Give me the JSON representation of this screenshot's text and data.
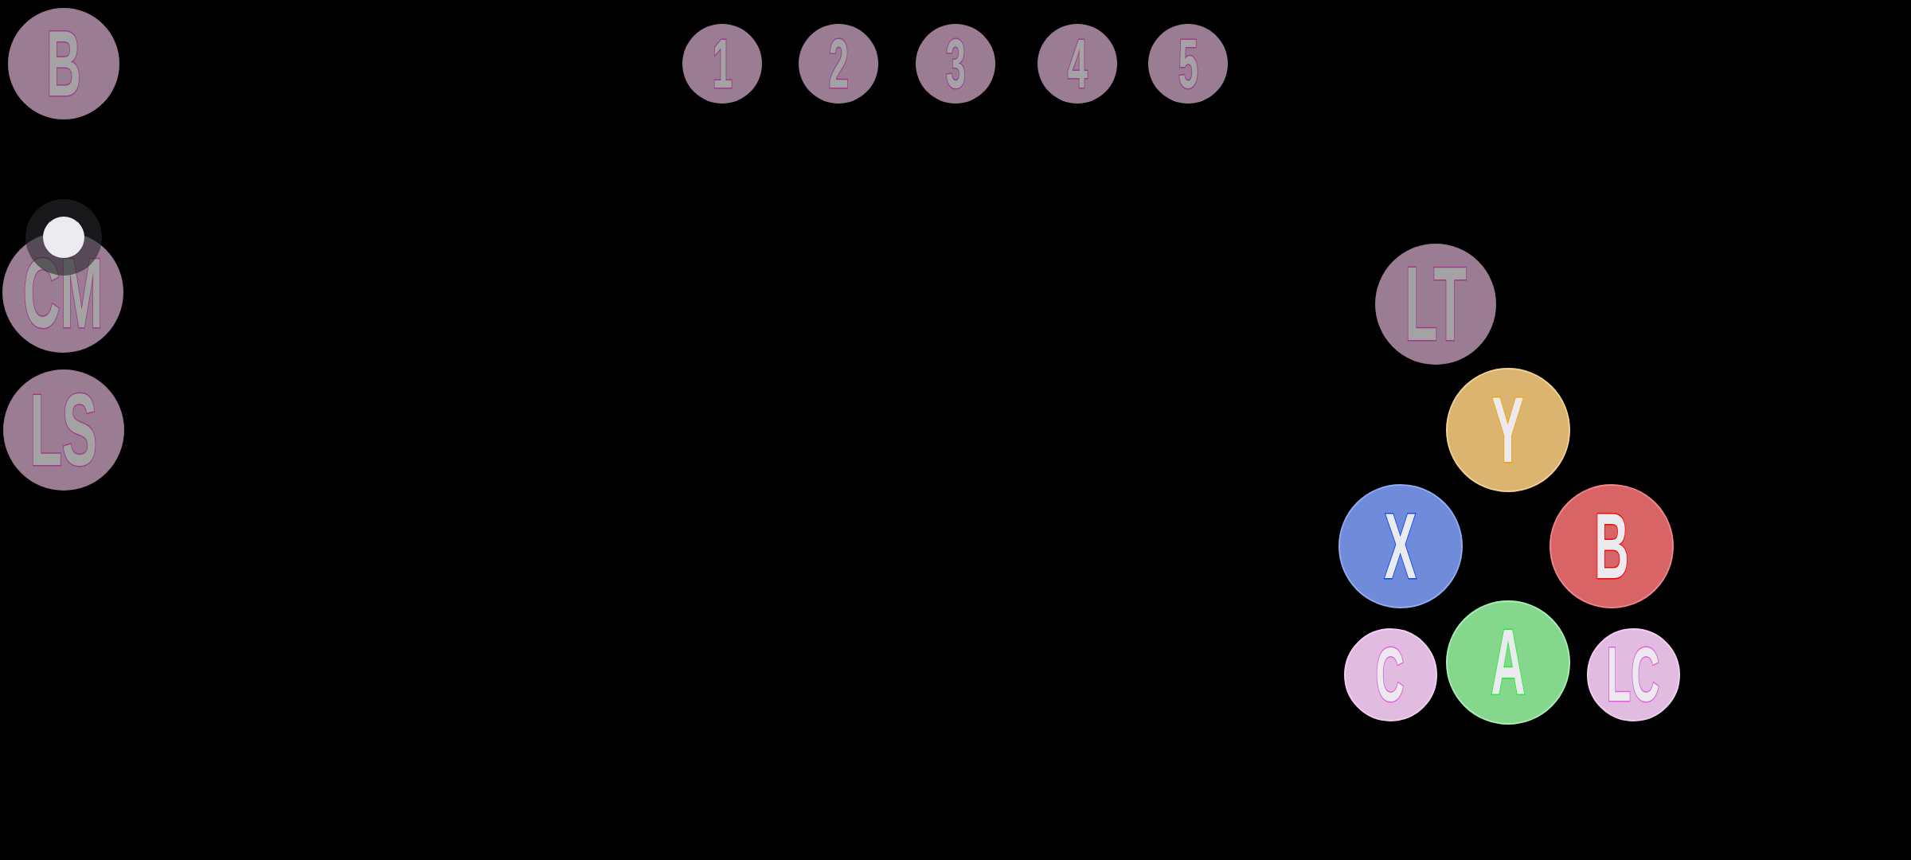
{
  "left_column": [
    {
      "label": "B",
      "color": "#9a7d93"
    },
    {
      "label": "CM",
      "color": "#9a7d93"
    },
    {
      "label": "LS",
      "color": "#9a7d93"
    }
  ],
  "number_row": [
    {
      "label": "1",
      "color": "#9a7d93"
    },
    {
      "label": "2",
      "color": "#9a7d93"
    },
    {
      "label": "3",
      "color": "#9a7d93"
    },
    {
      "label": "4",
      "color": "#9a7d93"
    },
    {
      "label": "5",
      "color": "#9a7d93"
    }
  ],
  "action_cluster": [
    {
      "label": "LT",
      "color": "#9a7d93"
    },
    {
      "label": "Y",
      "color": "#dbb46f"
    },
    {
      "label": "X",
      "color": "#6f8bd9"
    },
    {
      "label": "B",
      "color": "#d96466"
    },
    {
      "label": "C",
      "color": "#e2bce0"
    },
    {
      "label": "A",
      "color": "#86d78e"
    },
    {
      "label": "LC",
      "color": "#e2bce0"
    }
  ]
}
